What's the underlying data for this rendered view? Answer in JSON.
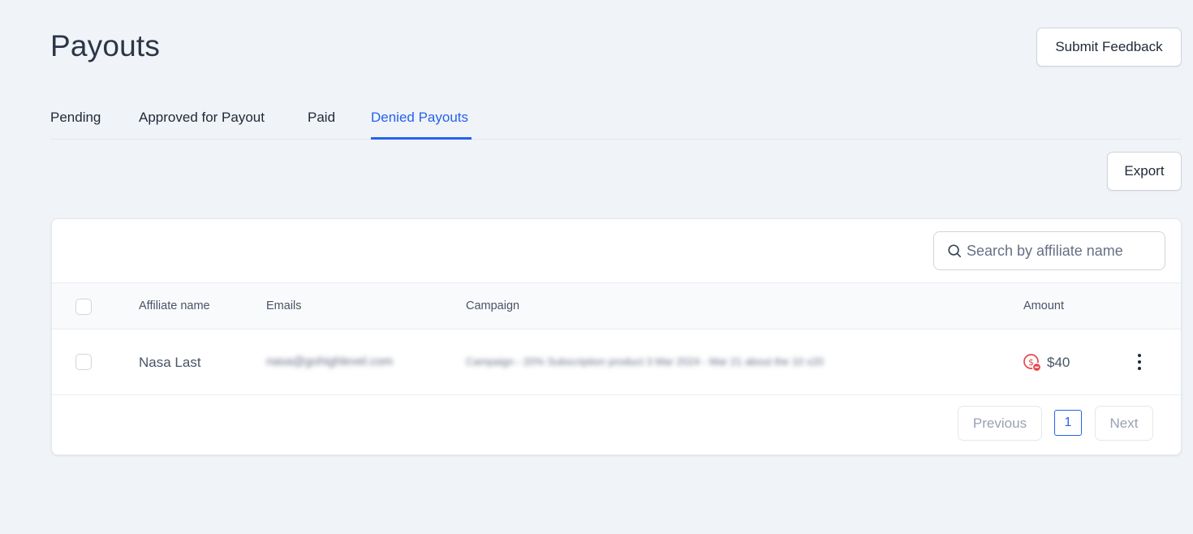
{
  "header": {
    "title": "Payouts",
    "feedback_label": "Submit Feedback"
  },
  "tabs": [
    {
      "label": "Pending",
      "active": false
    },
    {
      "label": "Approved for Payout",
      "active": false
    },
    {
      "label": "Paid",
      "active": false
    },
    {
      "label": "Denied Payouts",
      "active": true
    }
  ],
  "toolbar": {
    "export_label": "Export"
  },
  "search": {
    "placeholder": "Search by affiliate name",
    "icon": "search-icon"
  },
  "table": {
    "columns": [
      "Affiliate name",
      "Emails",
      "Campaign",
      "Amount"
    ],
    "rows": [
      {
        "affiliate_name": "Nasa Last",
        "email": "nasa@gohighlevel.com",
        "campaign": "Campaign - 20% Subscription product 3 Mar 2024 - Mar 21 about the 10 x20",
        "amount": "$40",
        "status_icon": "denied-dollar-icon",
        "status_color": "#e5484d"
      }
    ]
  },
  "pagination": {
    "previous_label": "Previous",
    "current_page": "1",
    "next_label": "Next"
  },
  "colors": {
    "accent": "#2563eb",
    "background": "#f0f3f7",
    "denied": "#e5484d"
  }
}
